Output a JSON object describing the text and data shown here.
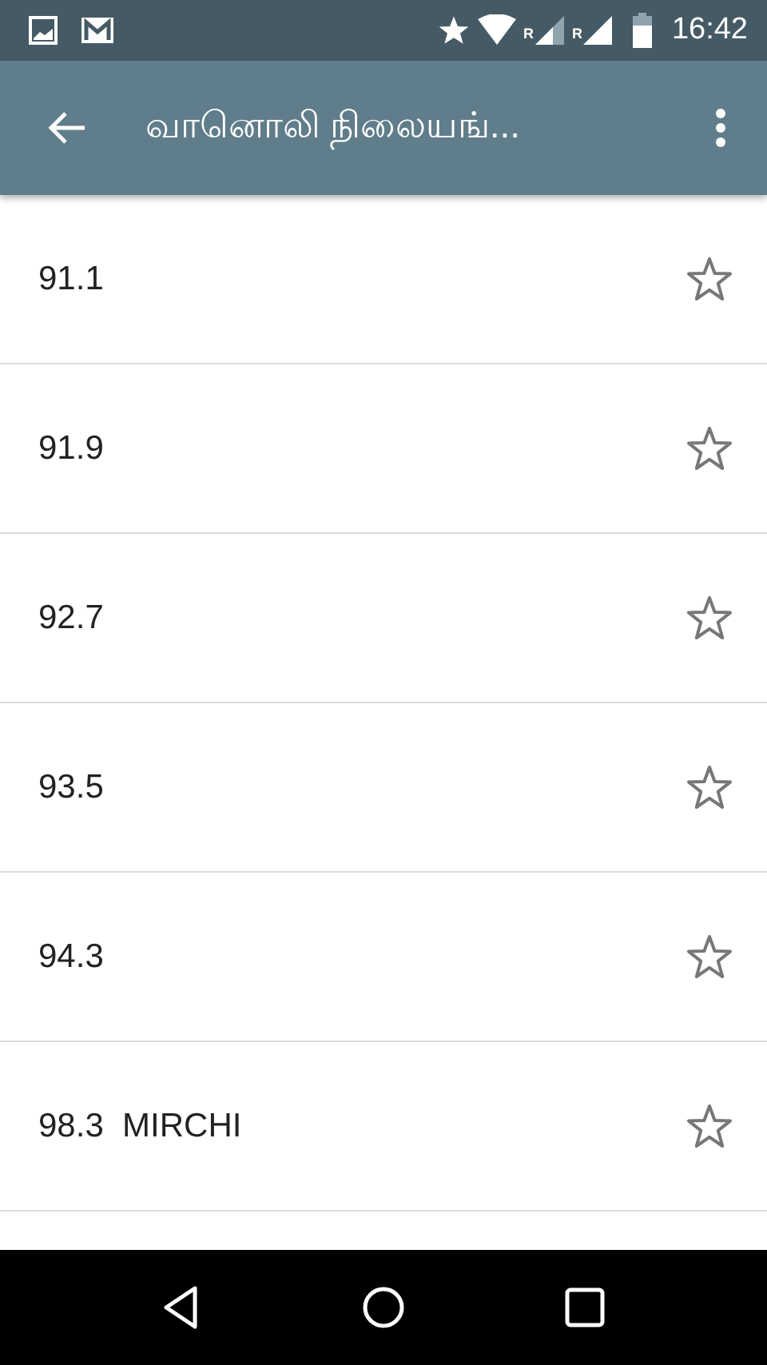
{
  "status_bar": {
    "roaming_marks": [
      "R",
      "R"
    ],
    "time": "16:42"
  },
  "app_bar": {
    "title": "வானொலி நிலையங்..."
  },
  "stations": [
    {
      "name": "91.1",
      "favorite": false
    },
    {
      "name": "91.9",
      "favorite": false
    },
    {
      "name": "92.7",
      "favorite": false
    },
    {
      "name": "93.5",
      "favorite": false
    },
    {
      "name": "94.3",
      "favorite": false
    },
    {
      "name": "98.3  MIRCHI",
      "favorite": false
    }
  ]
}
